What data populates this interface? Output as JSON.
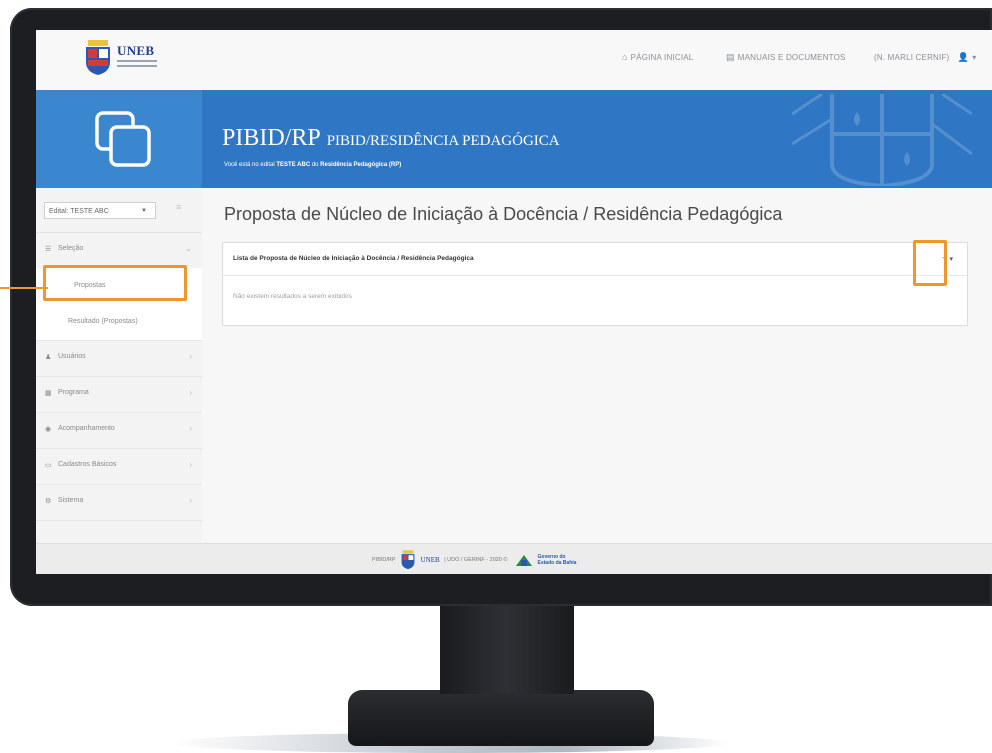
{
  "nav": {
    "logo_text": "UNEB",
    "home_label": "PÁGINA INICIAL",
    "manuals_label": "MANUAIS E DOCUMENTOS",
    "user_label": "(N. MARLI CERNIF)"
  },
  "banner": {
    "title": "PIBID/RP",
    "title_small": "PIBID/RESIDÊNCIA PEDAGÓGICA",
    "sub_prefix": "Você está no edital ",
    "sub_edital": "TESTE ABC",
    "sub_middle": " do ",
    "sub_program": "Residência Pedagógica (RP)"
  },
  "sidebar": {
    "edital_select": "Edital: TESTE ABC",
    "menu_selecao": "Seleção",
    "sub_propostas": "Propostas",
    "sub_resultado": "Resultado (Propostas)",
    "menu_usuarios": "Usuários",
    "menu_programa": "Programa",
    "menu_acompanhamento": "Acompanhamento",
    "menu_cadastros": "Cadastros Básicos",
    "menu_sistema": "Sistema"
  },
  "main": {
    "page_title": "Proposta de Núcleo de Iniciação à Docência / Residência Pedagógica",
    "panel_title": "Lista de Proposta de Núcleo de Iniciação à Docência / Residência Pedagógica",
    "panel_tools": "+",
    "empty_message": "Não existem resultados a serem exibidos"
  },
  "footer": {
    "left": "PIBID/RP",
    "logo_text": "UNEB",
    "middle": "| UDO / GERINF - 2020 ©",
    "gov": "Governo do Estado da Bahia"
  },
  "colors": {
    "banner_blue": "#2f77c4",
    "banner_left_blue": "#3a86cf",
    "highlight_orange": "#f0962f"
  }
}
